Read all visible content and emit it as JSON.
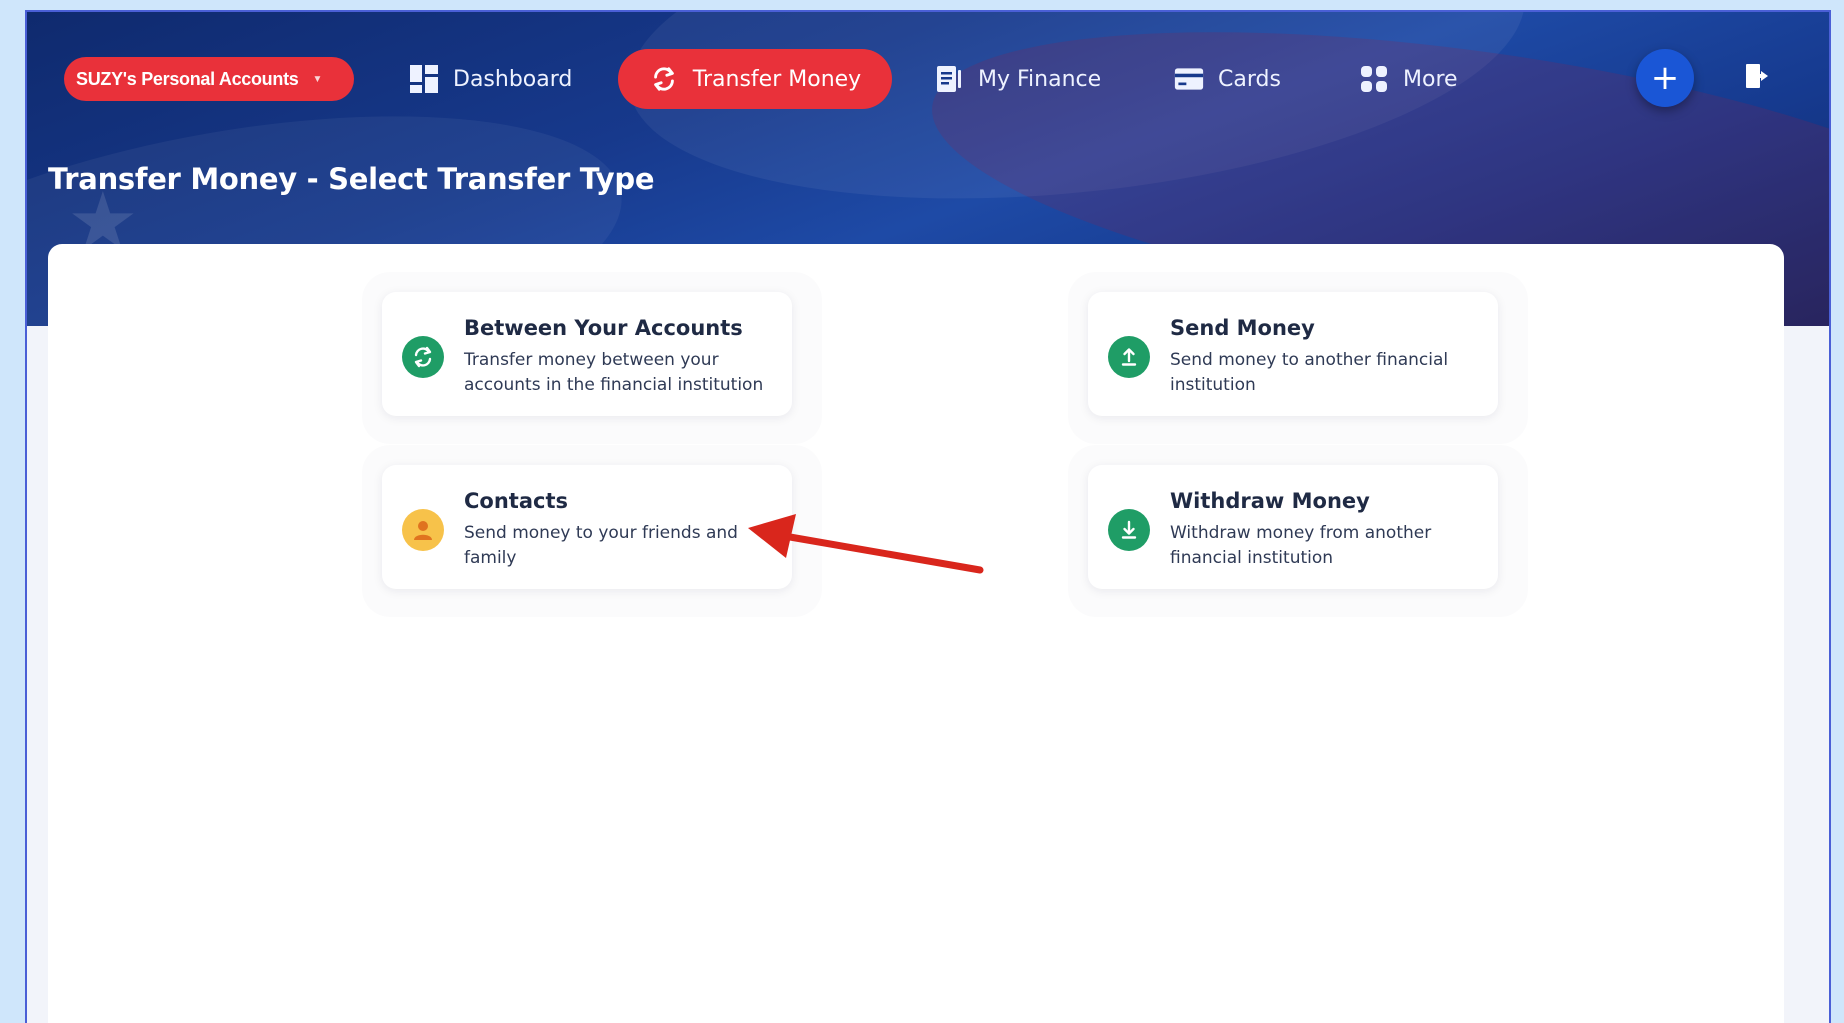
{
  "nav": {
    "account_label": "SUZY's Personal Accounts",
    "items": [
      {
        "label": "Dashboard"
      },
      {
        "label": "Transfer Money"
      },
      {
        "label": "My Finance"
      },
      {
        "label": "Cards"
      },
      {
        "label": "More"
      }
    ]
  },
  "page": {
    "title": "Transfer Money - Select Transfer Type"
  },
  "options": [
    {
      "title": "Between Your Accounts",
      "description": "Transfer money between your accounts in the financial institution",
      "icon": "refresh-icon",
      "color": "#1f9d66"
    },
    {
      "title": "Send Money",
      "description": "Send money to another financial institution",
      "icon": "upload-icon",
      "color": "#1f9d66"
    },
    {
      "title": "Contacts",
      "description": "Send money to your friends and family",
      "icon": "person-icon",
      "color": "#f7c24a"
    },
    {
      "title": "Withdraw Money",
      "description": "Withdraw money from another financial institution",
      "icon": "download-icon",
      "color": "#1f9d66"
    }
  ],
  "colors": {
    "accent_red": "#e9313a",
    "banner_blue": "#17398c",
    "plus_blue": "#1a56d6",
    "annotation_arrow": "#d9261c"
  }
}
